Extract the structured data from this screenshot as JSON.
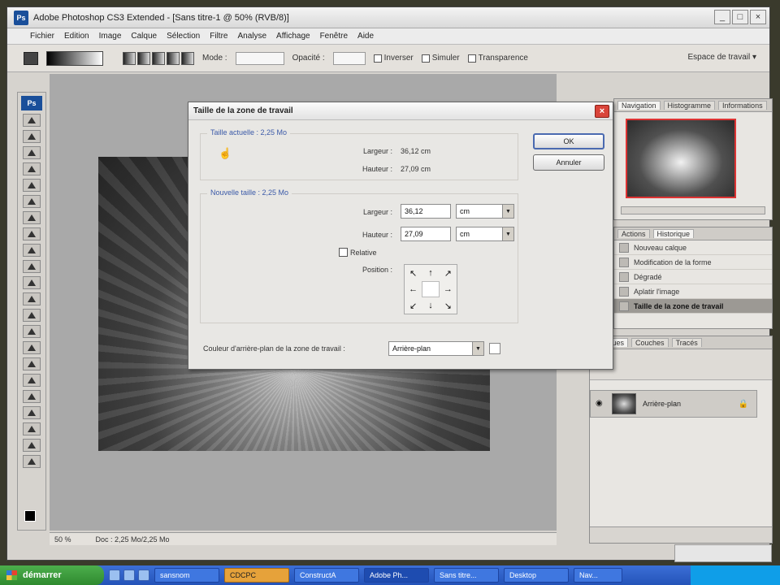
{
  "window": {
    "title": "Adobe Photoshop CS3 Extended - [Sans titre-1 @ 50% (RVB/8)]",
    "app_badge": "Ps"
  },
  "menu": [
    "Fichier",
    "Edition",
    "Image",
    "Calque",
    "Sélection",
    "Filtre",
    "Analyse",
    "Affichage",
    "Fenêtre",
    "Aide"
  ],
  "options": {
    "mode_label": "Mode :",
    "opacity_label": "Opacité :",
    "inverse": "Inverser",
    "dither": "Simuler",
    "transparency": "Transparence",
    "workspace": "Espace de travail ▾"
  },
  "dialog": {
    "title": "Taille de la zone de travail",
    "current_size_label": "Taille actuelle : 2,25 Mo",
    "current": {
      "width_label": "Largeur :",
      "width_value": "36,12 cm",
      "height_label": "Hauteur :",
      "height_value": "27,09 cm"
    },
    "new_size_label": "Nouvelle taille : 2,25 Mo",
    "new": {
      "width_label": "Largeur :",
      "width_value": "36,12",
      "width_unit": "cm",
      "height_label": "Hauteur :",
      "height_value": "27,09",
      "height_unit": "cm"
    },
    "relative": "Relative",
    "position_label": "Position :",
    "ok": "OK",
    "cancel": "Annuler",
    "bg_label": "Couleur d'arrière-plan de la zone de travail :",
    "bg_value": "Arrière-plan"
  },
  "navigator": {
    "tabs": [
      "Navigation",
      "Histogramme",
      "Informations"
    ]
  },
  "history": {
    "tabs": [
      "Actions",
      "Historique",
      "Historique"
    ],
    "items": [
      "Nouveau calque",
      "Modification de la forme",
      "Dégradé",
      "Aplatir l'image",
      "Taille de la zone de travail"
    ]
  },
  "layers": {
    "tabs": [
      "Calques",
      "Couches",
      "Tracés"
    ],
    "layer_name": "Arrière-plan"
  },
  "status": {
    "zoom": "50 %",
    "doc": "Doc : 2,25 Mo/2,25 Mo"
  },
  "taskbar": {
    "start": "démarrer",
    "tasks": [
      "sansnom",
      "CDCPC",
      "ConstructA",
      "Adobe Ph...",
      "Sans titre...",
      "Desktop",
      "Nav..."
    ]
  }
}
